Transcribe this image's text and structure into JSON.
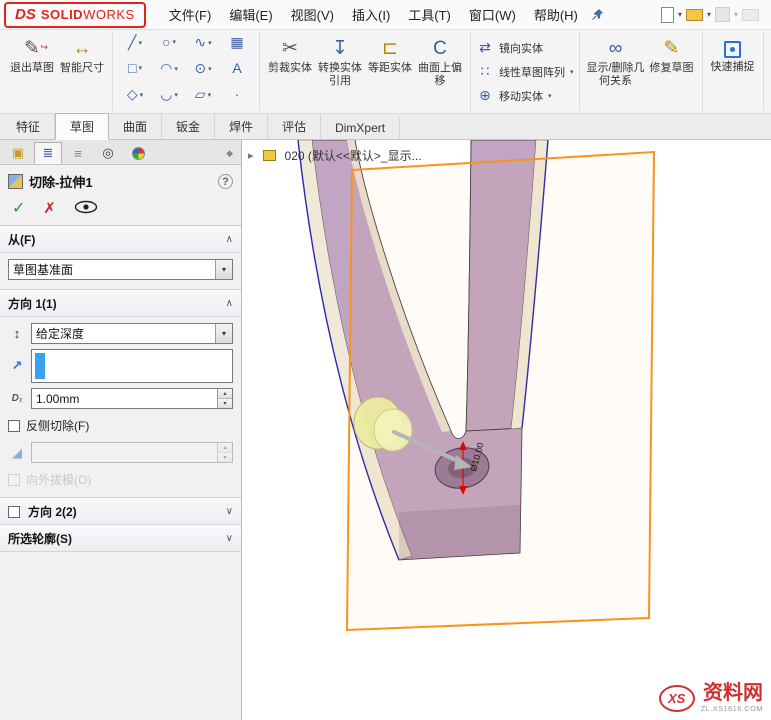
{
  "app": {
    "logo_ds": "DS",
    "logo_solid": "SOLID",
    "logo_works": "WORKS"
  },
  "menu": {
    "items": [
      "文件(F)",
      "编辑(E)",
      "视图(V)",
      "插入(I)",
      "工具(T)",
      "窗口(W)",
      "帮助(H)"
    ]
  },
  "glyphs": {
    "caret": "▾",
    "chevron_up": "∧",
    "chevron_down": "∨",
    "spin_up": "▴",
    "spin_down": "▾",
    "tree_arrow": "▸",
    "ok": "✓",
    "cancel": "✗",
    "help": "?",
    "splitter": "◆",
    "reverse_direction": "↕",
    "direction_arrow": "↗",
    "draft": "◢"
  },
  "toolbar": {
    "exit_sketch": {
      "label": "退出草图",
      "glyph": "✎",
      "badge": "↪"
    },
    "smart_dimension": {
      "label": "智能尺寸",
      "glyph": "↔"
    },
    "sketch_tools": [
      {
        "name": "line",
        "glyph": "╱"
      },
      {
        "name": "circle",
        "glyph": "○"
      },
      {
        "name": "spline",
        "glyph": "∿"
      },
      {
        "name": "sketch-picture",
        "glyph": "▦"
      },
      {
        "name": "rectangle",
        "glyph": "□"
      },
      {
        "name": "arc",
        "glyph": "◠"
      },
      {
        "name": "ellipse",
        "glyph": "⊙"
      },
      {
        "name": "text",
        "glyph": "A"
      },
      {
        "name": "polygon",
        "glyph": "◇"
      },
      {
        "name": "three-point-arc",
        "glyph": "◡"
      },
      {
        "name": "parallelogram",
        "glyph": "▱"
      },
      {
        "name": "point",
        "glyph": "·"
      }
    ],
    "trim": {
      "label": "剪裁实体",
      "glyph": "✂"
    },
    "convert": {
      "label": "转换实体引用",
      "glyph": "↧"
    },
    "offset": {
      "label": "等距实体",
      "glyph": "⊏"
    },
    "surface_offset": {
      "label": "曲面上偏移",
      "glyph": "C"
    },
    "mirror": {
      "label": "镜向实体",
      "glyph": "⇄"
    },
    "linear_pattern": {
      "label": "线性草图阵列",
      "glyph": "∷"
    },
    "move": {
      "label": "移动实体",
      "glyph": "⊕"
    },
    "display_delete_relations": {
      "label": "显示/删除几何关系",
      "glyph": "∞"
    },
    "repair_sketch": {
      "label": "修复草图",
      "glyph": "✎"
    },
    "quick_snaps": {
      "label": "快速捕捉"
    }
  },
  "ribbon_tabs": [
    {
      "label": "特征"
    },
    {
      "label": "草图"
    },
    {
      "label": "曲面"
    },
    {
      "label": "钣金"
    },
    {
      "label": "焊件"
    },
    {
      "label": "评估"
    },
    {
      "label": "DimXpert"
    }
  ],
  "property_panel": {
    "title": "切除-拉伸1",
    "from": {
      "header": "从(F)",
      "plane": "草图基准面"
    },
    "direction1": {
      "header": "方向 1(1)",
      "end_condition": "给定深度",
      "depth_icon": "D₁",
      "depth": "1.00mm",
      "flip_side": "反侧切除(F)",
      "draft_outward": "向外拔模(O)"
    },
    "direction2": {
      "header": "方向 2(2)"
    },
    "selected_contours": {
      "header": "所选轮廓(S)"
    }
  },
  "viewport": {
    "tree_item": "020 (默认<<默认>_显示...",
    "dim_text": "Ø10.00"
  },
  "watermark": {
    "logo": "XS",
    "site": "资料网",
    "domain": "ZL.XS1616.COM"
  },
  "colors": {
    "solidworks_red": "#e2231a",
    "plane_orange": "#F7941D",
    "model_purple": "#c2a5c2",
    "selection_blue": "#3aa0f0",
    "preview_yellow": "#ededa0"
  }
}
